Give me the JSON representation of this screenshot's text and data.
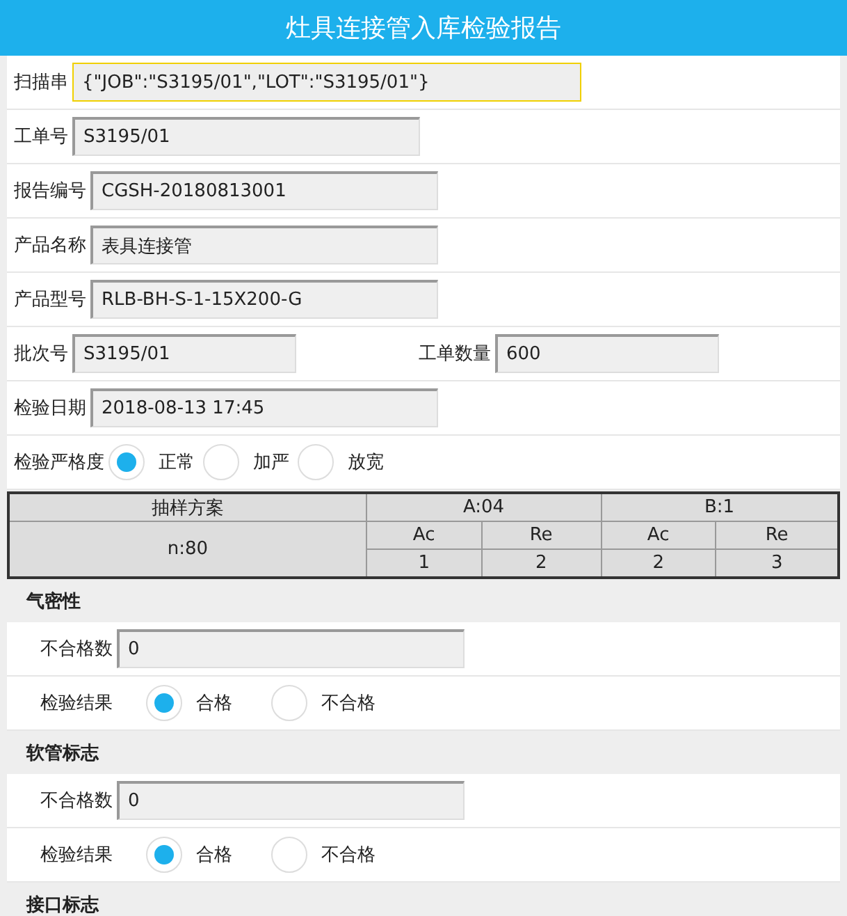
{
  "title": "灶具连接管入库检验报告",
  "scan": {
    "label": "扫描串",
    "value": "{\"JOB\":\"S3195/01\",\"LOT\":\"S3195/01\"}"
  },
  "rows": [
    {
      "kind": "single",
      "fields": [
        {
          "label": "工单号",
          "value": "S3195/01"
        }
      ]
    },
    {
      "kind": "single",
      "fields": [
        {
          "label": "报告编号",
          "value": "CGSH-20180813001"
        }
      ]
    },
    {
      "kind": "single",
      "fields": [
        {
          "label": "产品名称",
          "value": "表具连接管"
        }
      ]
    },
    {
      "kind": "single",
      "fields": [
        {
          "label": "产品型号",
          "value": "RLB-BH-S-1-15X200-G"
        }
      ]
    },
    {
      "kind": "pair",
      "fields": [
        {
          "label": "批次号",
          "value": "S3195/01"
        },
        {
          "label": "工单数量",
          "value": "600"
        }
      ]
    },
    {
      "kind": "single",
      "fields": [
        {
          "label": "检验日期",
          "value": "2018-08-13 17:45"
        }
      ]
    }
  ],
  "strictness": {
    "label": "检验严格度",
    "options": [
      {
        "label": "正常",
        "selected": true
      },
      {
        "label": "加严",
        "selected": false
      },
      {
        "label": "放宽",
        "selected": false
      }
    ]
  },
  "sampling": {
    "header": "抽样方案",
    "sample": "n:80",
    "groups": [
      {
        "name": "A:04",
        "ac_label": "Ac",
        "re_label": "Re",
        "ac": "1",
        "re": "2"
      },
      {
        "name": "B:1",
        "ac_label": "Ac",
        "re_label": "Re",
        "ac": "2",
        "re": "3"
      }
    ]
  },
  "sections": [
    {
      "title": "气密性",
      "defects": {
        "label": "不合格数",
        "value": "0"
      },
      "result": {
        "label": "检验结果",
        "options": [
          {
            "label": "合格",
            "selected": true
          },
          {
            "label": "不合格",
            "selected": false
          }
        ]
      }
    },
    {
      "title": "软管标志",
      "defects": {
        "label": "不合格数",
        "value": "0"
      },
      "result": {
        "label": "检验结果",
        "options": [
          {
            "label": "合格",
            "selected": true
          },
          {
            "label": "不合格",
            "selected": false
          }
        ]
      }
    },
    {
      "title": "接口标志"
    }
  ]
}
